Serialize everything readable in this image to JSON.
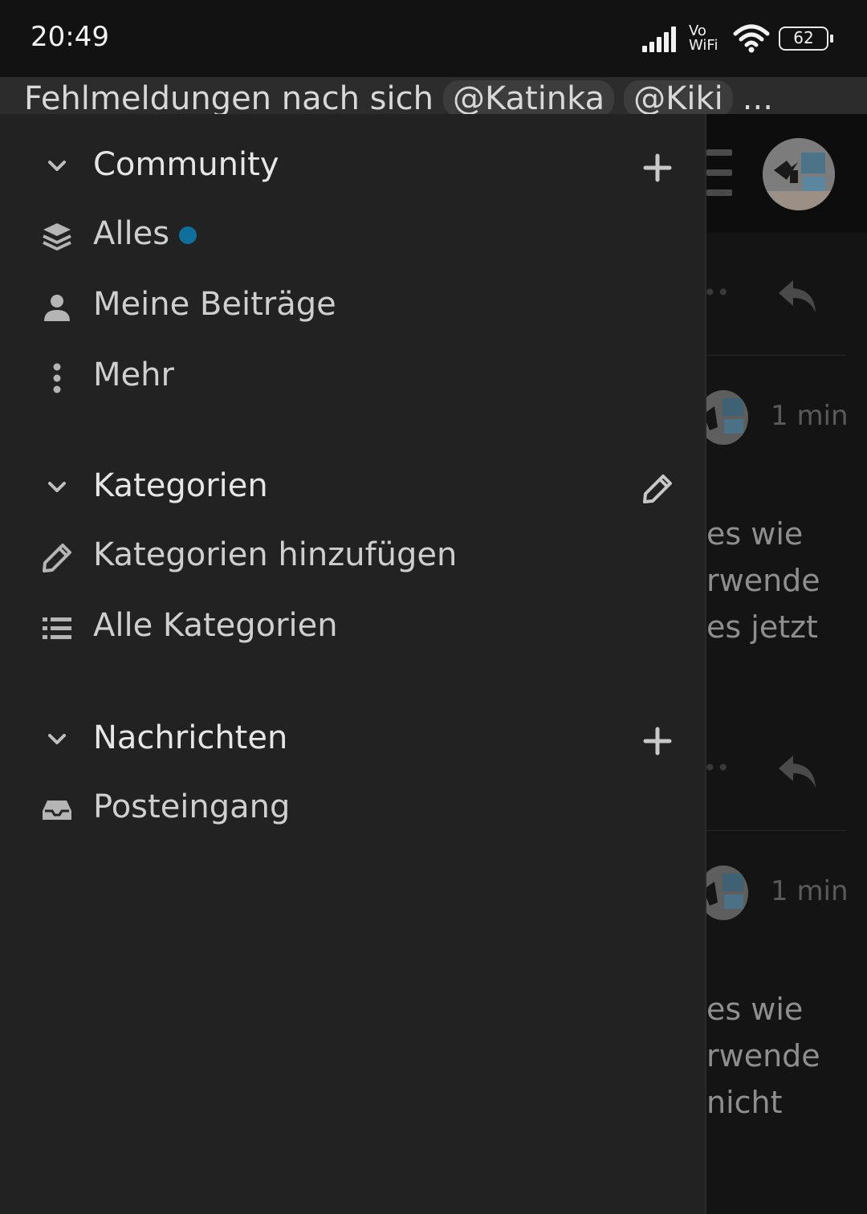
{
  "status_bar": {
    "time": "20:49",
    "network_label": "Vo WiFi",
    "battery": "62",
    "icons": [
      "signal-icon",
      "wifi-icon",
      "battery-icon"
    ]
  },
  "topic": {
    "title": "Fehlmeldungen nach sich",
    "mentions": [
      "@Katinka",
      "@Kiki"
    ],
    "ellipsis": "..."
  },
  "posts": [
    {
      "time": "1 min",
      "text_lines": [
        "es wie",
        "rwende",
        "es jetzt"
      ]
    },
    {
      "time": "1 min",
      "text_lines": [
        "es wie",
        "rwende",
        "nicht"
      ]
    }
  ],
  "drawer": {
    "community": {
      "label": "Community",
      "items": [
        {
          "label": "Alles",
          "icon": "layers-icon",
          "has_unread_dot": true
        },
        {
          "label": "Meine Beiträge",
          "icon": "user-icon"
        },
        {
          "label": "Mehr",
          "icon": "more-vertical-icon"
        }
      ]
    },
    "categories": {
      "label": "Kategorien",
      "items": [
        {
          "label": "Kategorien hinzufügen",
          "icon": "pencil-icon"
        },
        {
          "label": "Alle Kategorien",
          "icon": "list-icon"
        }
      ]
    },
    "messages": {
      "label": "Nachrichten",
      "items": [
        {
          "label": "Posteingang",
          "icon": "inbox-icon"
        }
      ]
    }
  },
  "colors": {
    "drawer_bg": "#222222",
    "unread_dot": "#0e6f9c",
    "status_bar_bg": "#121212"
  }
}
